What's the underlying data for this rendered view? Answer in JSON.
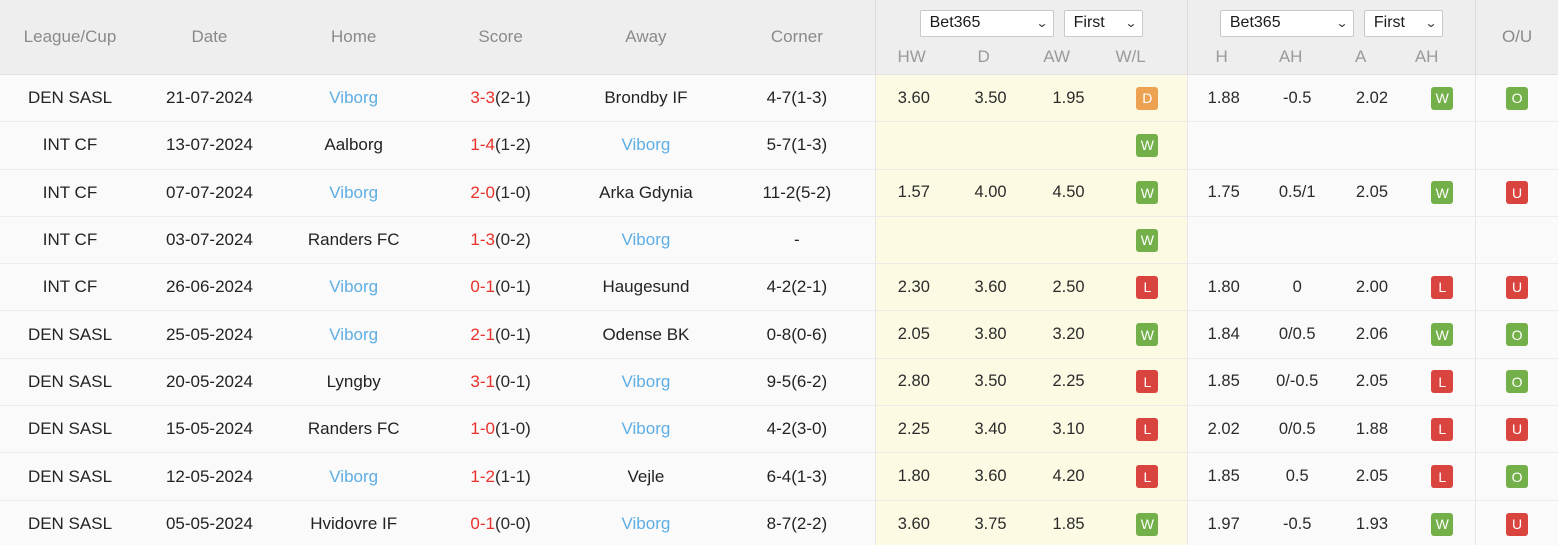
{
  "header": {
    "columns": [
      "League/Cup",
      "Date",
      "Home",
      "Score",
      "Away",
      "Corner"
    ],
    "odds_group_left": {
      "bookmaker": "Bet365",
      "period": "First",
      "sub": [
        "HW",
        "D",
        "AW",
        "W/L"
      ]
    },
    "odds_group_right": {
      "bookmaker": "Bet365",
      "period": "First",
      "sub": [
        "H",
        "AH",
        "A",
        "AH"
      ]
    },
    "ou_label": "O/U",
    "caret": "⌄"
  },
  "colors": {
    "link": "#5eaee4",
    "score": "#e8312a",
    "win": "#74b04a",
    "lose": "#d9443f",
    "draw": "#eda252",
    "odds_bg": "#fdfae3",
    "header_bg": "#eeeeee"
  },
  "rows": [
    {
      "league": "DEN SASL",
      "date": "21-07-2024",
      "home": "Viborg",
      "home_link": true,
      "score_main": "3-3",
      "score_ht": "(2-1)",
      "away": "Brondby IF",
      "away_link": false,
      "corner": "4-7(1-3)",
      "hw": "3.60",
      "d": "3.50",
      "aw": "1.95",
      "wl": "D",
      "h": "1.88",
      "ah1": "-0.5",
      "a": "2.02",
      "ah2": "W",
      "ou": "O"
    },
    {
      "league": "INT CF",
      "date": "13-07-2024",
      "home": "Aalborg",
      "home_link": false,
      "score_main": "1-4",
      "score_ht": "(1-2)",
      "away": "Viborg",
      "away_link": true,
      "corner": "5-7(1-3)",
      "hw": "",
      "d": "",
      "aw": "",
      "wl": "W",
      "h": "",
      "ah1": "",
      "a": "",
      "ah2": "",
      "ou": ""
    },
    {
      "league": "INT CF",
      "date": "07-07-2024",
      "home": "Viborg",
      "home_link": true,
      "score_main": "2-0",
      "score_ht": "(1-0)",
      "away": "Arka Gdynia",
      "away_link": false,
      "corner": "11-2(5-2)",
      "hw": "1.57",
      "d": "4.00",
      "aw": "4.50",
      "wl": "W",
      "h": "1.75",
      "ah1": "0.5/1",
      "a": "2.05",
      "ah2": "W",
      "ou": "U"
    },
    {
      "league": "INT CF",
      "date": "03-07-2024",
      "home": "Randers FC",
      "home_link": false,
      "score_main": "1-3",
      "score_ht": "(0-2)",
      "away": "Viborg",
      "away_link": true,
      "corner": "-",
      "hw": "",
      "d": "",
      "aw": "",
      "wl": "W",
      "h": "",
      "ah1": "",
      "a": "",
      "ah2": "",
      "ou": ""
    },
    {
      "league": "INT CF",
      "date": "26-06-2024",
      "home": "Viborg",
      "home_link": true,
      "score_main": "0-1",
      "score_ht": "(0-1)",
      "away": "Haugesund",
      "away_link": false,
      "corner": "4-2(2-1)",
      "hw": "2.30",
      "d": "3.60",
      "aw": "2.50",
      "wl": "L",
      "h": "1.80",
      "ah1": "0",
      "a": "2.00",
      "ah2": "L",
      "ou": "U"
    },
    {
      "league": "DEN SASL",
      "date": "25-05-2024",
      "home": "Viborg",
      "home_link": true,
      "score_main": "2-1",
      "score_ht": "(0-1)",
      "away": "Odense BK",
      "away_link": false,
      "corner": "0-8(0-6)",
      "hw": "2.05",
      "d": "3.80",
      "aw": "3.20",
      "wl": "W",
      "h": "1.84",
      "ah1": "0/0.5",
      "a": "2.06",
      "ah2": "W",
      "ou": "O"
    },
    {
      "league": "DEN SASL",
      "date": "20-05-2024",
      "home": "Lyngby",
      "home_link": false,
      "score_main": "3-1",
      "score_ht": "(0-1)",
      "away": "Viborg",
      "away_link": true,
      "corner": "9-5(6-2)",
      "hw": "2.80",
      "d": "3.50",
      "aw": "2.25",
      "wl": "L",
      "h": "1.85",
      "ah1": "0/-0.5",
      "a": "2.05",
      "ah2": "L",
      "ou": "O"
    },
    {
      "league": "DEN SASL",
      "date": "15-05-2024",
      "home": "Randers FC",
      "home_link": false,
      "score_main": "1-0",
      "score_ht": "(1-0)",
      "away": "Viborg",
      "away_link": true,
      "corner": "4-2(3-0)",
      "hw": "2.25",
      "d": "3.40",
      "aw": "3.10",
      "wl": "L",
      "h": "2.02",
      "ah1": "0/0.5",
      "a": "1.88",
      "ah2": "L",
      "ou": "U"
    },
    {
      "league": "DEN SASL",
      "date": "12-05-2024",
      "home": "Viborg",
      "home_link": true,
      "score_main": "1-2",
      "score_ht": "(1-1)",
      "away": "Vejle",
      "away_link": false,
      "corner": "6-4(1-3)",
      "hw": "1.80",
      "d": "3.60",
      "aw": "4.20",
      "wl": "L",
      "h": "1.85",
      "ah1": "0.5",
      "a": "2.05",
      "ah2": "L",
      "ou": "O"
    },
    {
      "league": "DEN SASL",
      "date": "05-05-2024",
      "home": "Hvidovre IF",
      "home_link": false,
      "score_main": "0-1",
      "score_ht": "(0-0)",
      "away": "Viborg",
      "away_link": true,
      "corner": "8-7(2-2)",
      "hw": "3.60",
      "d": "3.75",
      "aw": "1.85",
      "wl": "W",
      "h": "1.97",
      "ah1": "-0.5",
      "a": "1.93",
      "ah2": "W",
      "ou": "U"
    }
  ]
}
